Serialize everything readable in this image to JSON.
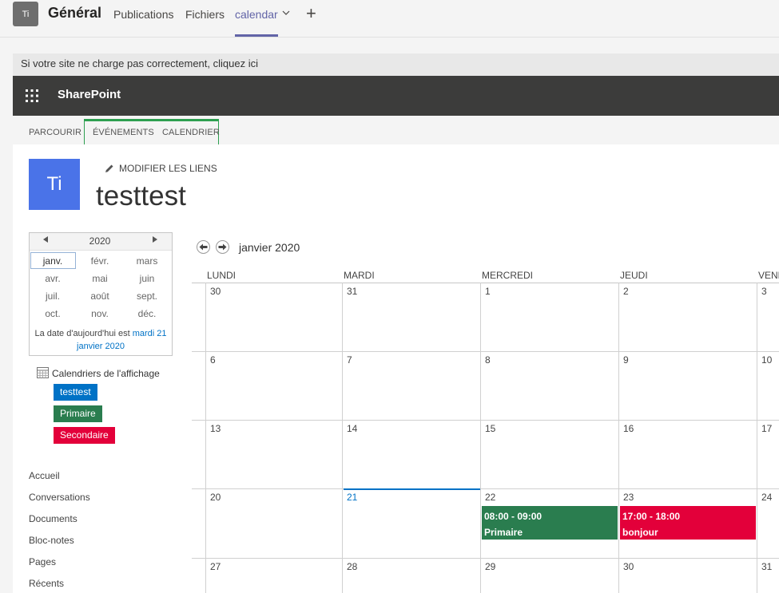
{
  "teams": {
    "avatar": "Ti",
    "channel": "Général",
    "tabs": [
      "Publications",
      "Fichiers",
      "calendar"
    ],
    "add": "+"
  },
  "banner": "Si votre site ne charge pas correctement, cliquez ici",
  "suite": {
    "title": "SharePoint"
  },
  "ribbon": {
    "tabs": [
      "PARCOURIR",
      "ÉVÉNEMENTS",
      "CALENDRIER"
    ]
  },
  "site": {
    "logo": "Ti",
    "edit_links": "MODIFIER LES LIENS",
    "title": "testtest"
  },
  "picker": {
    "year": "2020",
    "months": [
      "janv.",
      "févr.",
      "mars",
      "avr.",
      "mai",
      "juin",
      "juil.",
      "août",
      "sept.",
      "oct.",
      "nov.",
      "déc."
    ],
    "today_prefix": "La date d'aujourd'hui est ",
    "today_link": "mardi 21 janvier 2020"
  },
  "calendars": {
    "title": "Calendriers de l'affichage",
    "items": [
      "testtest",
      "Primaire",
      "Secondaire"
    ]
  },
  "nav": [
    "Accueil",
    "Conversations",
    "Documents",
    "Bloc-notes",
    "Pages",
    "Récents"
  ],
  "calendar": {
    "month_label": "janvier 2020",
    "day_headers": [
      "LUNDI",
      "MARDI",
      "MERCREDI",
      "JEUDI",
      "VENDREDI"
    ],
    "weeks": [
      [
        "30",
        "31",
        "1",
        "2",
        "3"
      ],
      [
        "6",
        "7",
        "8",
        "9",
        "10"
      ],
      [
        "13",
        "14",
        "15",
        "16",
        "17"
      ],
      [
        "20",
        "21",
        "22",
        "23",
        "24"
      ],
      [
        "27",
        "28",
        "29",
        "30",
        "31"
      ]
    ],
    "events": [
      {
        "time": "08:00 - 09:00",
        "title": "Primaire"
      },
      {
        "time": "17:00 - 18:00",
        "title": "bonjour"
      }
    ]
  },
  "colors": {
    "teams_accent": "#6264a7",
    "primaire": "#2a7d4f",
    "secondaire": "#e3003a",
    "testtest": "#0072c6"
  }
}
